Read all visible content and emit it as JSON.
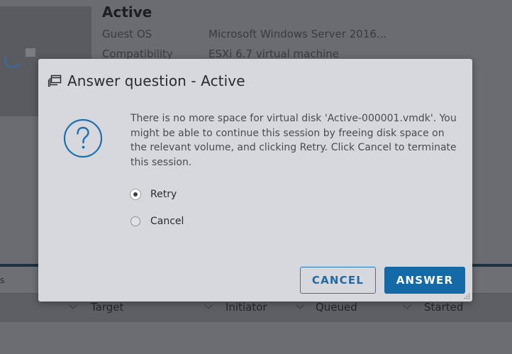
{
  "background": {
    "vm_name": "Active",
    "details": [
      {
        "label": "Guest OS",
        "value": "Microsoft Windows Server 2016..."
      },
      {
        "label": "Compatibility",
        "value": "ESXi 6.7 virtual machine"
      }
    ],
    "edge_text": "s",
    "table_columns": [
      "Target",
      "Initiator",
      "Queued",
      "Started"
    ]
  },
  "dialog": {
    "title": "Answer question - Active",
    "message": "There is no more space for virtual disk 'Active-000001.vmdk'. You might be able to continue this session by freeing disk space on the relevant volume, and clicking Retry. Click Cancel to terminate this session.",
    "options": [
      {
        "label": "Retry",
        "selected": true
      },
      {
        "label": "Cancel",
        "selected": false
      }
    ],
    "cancel_label": "CANCEL",
    "answer_label": "ANSWER"
  },
  "colors": {
    "primary": "#136aa6",
    "dialog_bg": "#d7d8de",
    "question_icon": "#1c6fb0"
  },
  "icons": {
    "header": "dialog-window-icon",
    "question": "question-circle-icon"
  }
}
